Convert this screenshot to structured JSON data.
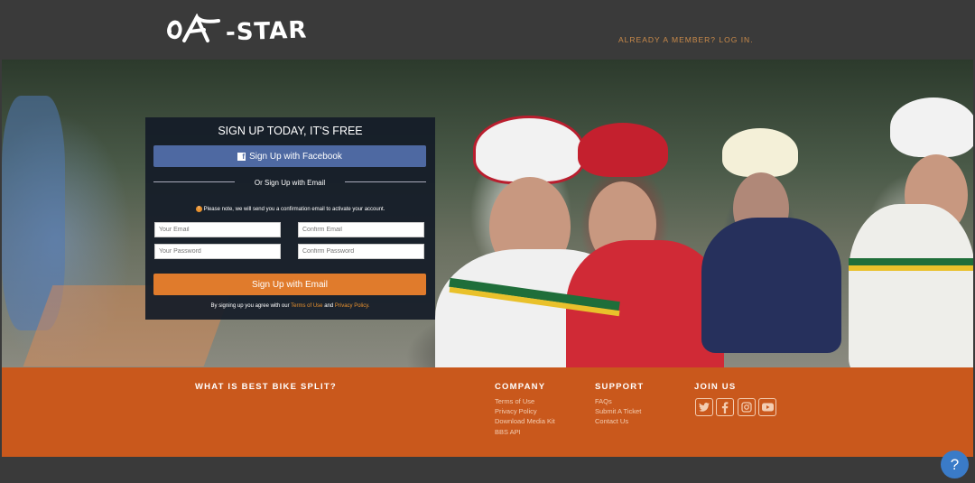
{
  "header": {
    "logo_text": "-STAR",
    "member_link": "ALREADY A MEMBER? LOG IN."
  },
  "signup": {
    "title": "SIGN UP TODAY, IT'S FREE",
    "facebook_button": "Sign Up with Facebook",
    "or_text": "Or Sign Up with Email",
    "note": "Please note, we will send you a confirmation email to activate your account.",
    "email_placeholder": "Your Email",
    "confirm_email_placeholder": "Confirm Email",
    "password_placeholder": "Your Password",
    "confirm_password_placeholder": "Confirm Password",
    "email_button": "Sign Up with Email",
    "terms_prefix": "By signing up you agree with our",
    "terms_link": "Terms of Use",
    "terms_and": "and",
    "privacy_link": "Privacy Policy."
  },
  "footer": {
    "about_heading": "WHAT IS BEST BIKE SPLIT?",
    "company_heading": "COMPANY",
    "company_links": [
      "Terms of Use",
      "Privacy Policy",
      "Download Media Kit",
      "BBS API"
    ],
    "support_heading": "SUPPORT",
    "support_links": [
      "FAQs",
      "Submit A Ticket",
      "Contact Us"
    ],
    "join_heading": "JOIN US",
    "social_icons": [
      "twitter-icon",
      "facebook-icon",
      "instagram-icon",
      "youtube-icon"
    ]
  },
  "help_button": "?",
  "colors": {
    "header_bg": "#3a3a3a",
    "footer_bg": "#c9581c",
    "facebook_blue": "#4e69a2",
    "email_orange": "#e07b2c",
    "help_blue": "#3a7bc8"
  }
}
